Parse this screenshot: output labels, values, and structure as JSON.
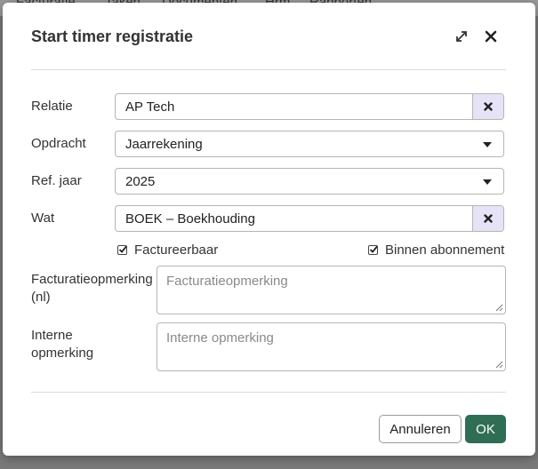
{
  "background": {
    "nav": [
      "Facturatie",
      "Taken",
      "Documenten",
      "Hrm",
      "Rapporten"
    ]
  },
  "modal": {
    "title": "Start timer registratie",
    "fields": {
      "relatie": {
        "label": "Relatie",
        "value": "AP Tech"
      },
      "opdracht": {
        "label": "Opdracht",
        "value": "Jaarrekening"
      },
      "ref_jaar": {
        "label": "Ref. jaar",
        "value": "2025"
      },
      "wat": {
        "label": "Wat",
        "value": "BOEK – Boekhouding"
      }
    },
    "checkboxes": {
      "factureerbaar": {
        "label": "Factureerbaar",
        "checked": true
      },
      "binnen_abonnement": {
        "label": "Binnen abonnement",
        "checked": true
      }
    },
    "facturatieopmerking": {
      "label_line1": "Facturatieopmerking",
      "label_line2": "(nl)",
      "placeholder": "Facturatieopmerking"
    },
    "interne_opmerking": {
      "label_line1": "Interne",
      "label_line2": "opmerking",
      "placeholder": "Interne opmerking"
    },
    "buttons": {
      "cancel": "Annuleren",
      "ok": "OK"
    }
  },
  "icons": [
    "expand-icon",
    "close-icon",
    "clear-icon",
    "caret-down-icon",
    "check-icon"
  ],
  "colors": {
    "primary": "#2f6e55",
    "clear_bg": "#e6e3f7"
  }
}
